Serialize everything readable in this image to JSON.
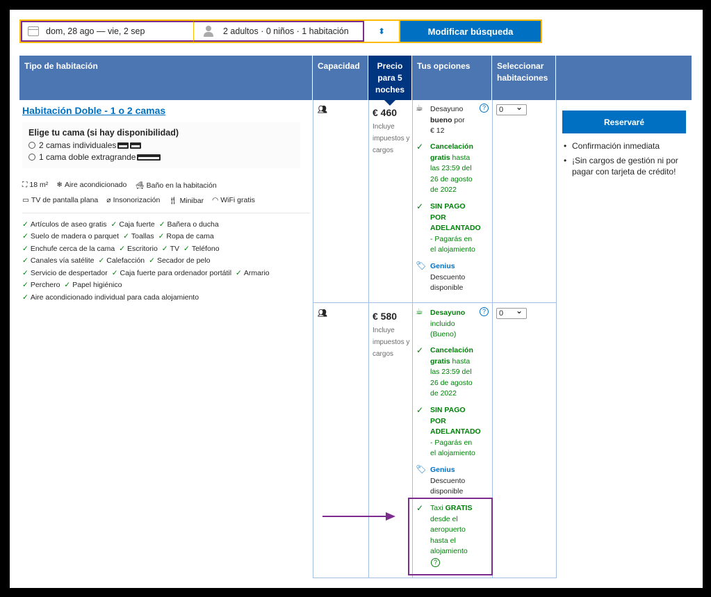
{
  "search": {
    "dates": "dom, 28 ago — vie, 2 sep",
    "guests": "2 adultos · 0 niños · 1 habitación",
    "caret": "⌃⌄",
    "button": "Modificar búsqueda"
  },
  "headers": {
    "room_type": "Tipo de habitación",
    "capacity": "Capacidad",
    "price": "Precio para 5 noches",
    "options": "Tus opciones",
    "select": "Seleccionar habitaciones"
  },
  "room": {
    "title": "Habitación Doble - 1 o 2 camas",
    "bed_title": "Elige tu cama (si hay disponibilidad)",
    "bed_options": [
      "2 camas individuales",
      "1 cama doble extragrande"
    ],
    "facilities_row1": [
      "18 m²",
      "Aire acondicionado",
      "Baño en la habitación"
    ],
    "facilities_row2": [
      "TV de pantalla plana",
      "Insonorización",
      "Minibar",
      "WiFi gratis"
    ],
    "amenities": [
      [
        "Artículos de aseo gratis",
        "Caja fuerte",
        "Bañera o ducha"
      ],
      [
        "Suelo de madera o parquet",
        "Toallas",
        "Ropa de cama"
      ],
      [
        "Enchufe cerca de la cama",
        "Escritorio",
        "TV",
        "Teléfono"
      ],
      [
        "Canales vía satélite",
        "Calefacción",
        "Secador de pelo"
      ],
      [
        "Servicio de despertador",
        "Caja fuerte para ordenador portátil",
        "Armario"
      ],
      [
        "Perchero",
        "Papel higiénico"
      ],
      [
        "Aire acondicionado individual para cada alojamiento"
      ]
    ]
  },
  "offers": [
    {
      "price": "€ 460",
      "price_note": "Incluye impuestos y cargos",
      "breakfast_l1": "Desayuno",
      "breakfast_l2b": "bueno",
      "breakfast_l2": " por",
      "breakfast_l3": "€ 12",
      "cancel": [
        "Cancelación",
        "gratis",
        " hasta",
        "las 23:59 del",
        "26 de agosto",
        "de 2022"
      ],
      "nopay": [
        "SIN PAGO",
        "POR",
        "ADELANTADO",
        "- Pagarás en",
        "el alojamiento"
      ],
      "genius": "Genius",
      "discount": [
        "Descuento",
        "disponible"
      ],
      "qty": "0"
    },
    {
      "price": "€ 580",
      "price_note": "Incluye impuestos y cargos",
      "breakfast_l1": "Desayuno",
      "breakfast_l2": "incluido",
      "breakfast_l3": "(Bueno)",
      "cancel": [
        "Cancelación",
        "gratis",
        " hasta",
        "las 23:59 del",
        "26 de agosto",
        "de 2022"
      ],
      "nopay": [
        "SIN PAGO",
        "POR",
        "ADELANTADO",
        "- Pagarás en",
        "el alojamiento"
      ],
      "genius": "Genius",
      "discount": [
        "Descuento",
        "disponible"
      ],
      "taxi": [
        "Taxi ",
        "GRATIS",
        "desde el",
        "aeropuerto",
        "hasta el",
        "alojamiento"
      ],
      "qty": "0"
    }
  ],
  "reserve": {
    "button": "Reservaré",
    "bullets": [
      "Confirmación inmediata",
      "¡Sin cargos de gestión ni por pagar con tarjeta de crédito!"
    ]
  },
  "colors": {
    "accent": "#0071c2",
    "header": "#4c76b2",
    "price_header": "#003580",
    "green": "#008009",
    "highlight": "#7b2c8e",
    "search_border": "#febb02"
  }
}
